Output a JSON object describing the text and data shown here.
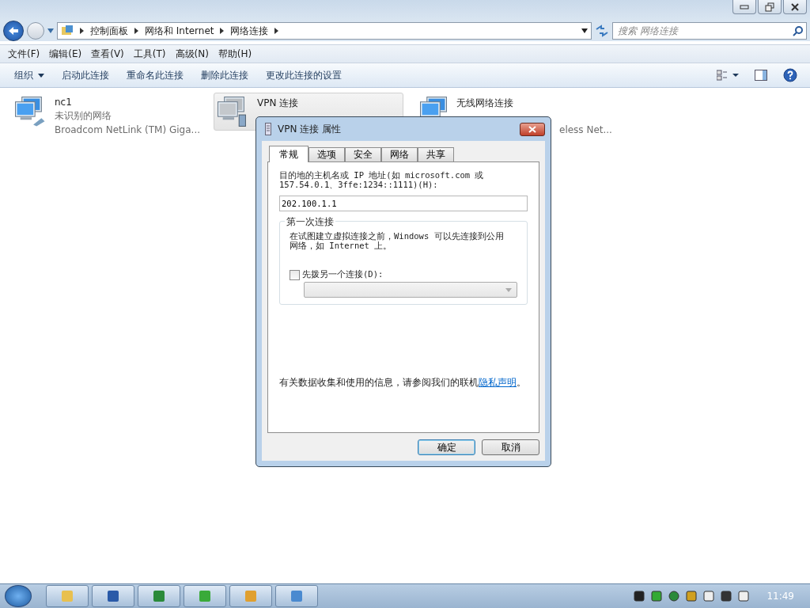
{
  "address_bar": {
    "path": [
      "控制面板",
      "网络和 Internet",
      "网络连接"
    ]
  },
  "search": {
    "placeholder": "搜索 网络连接"
  },
  "menu": [
    "文件(F)",
    "编辑(E)",
    "查看(V)",
    "工具(T)",
    "高级(N)",
    "帮助(H)"
  ],
  "commands": [
    {
      "label": "组织",
      "dropdown": true
    },
    {
      "label": "启动此连接",
      "dropdown": false
    },
    {
      "label": "重命名此连接",
      "dropdown": false
    },
    {
      "label": "删除此连接",
      "dropdown": false
    },
    {
      "label": "更改此连接的设置",
      "dropdown": false
    }
  ],
  "connections": [
    {
      "kind": "wired",
      "name": "nc1",
      "status": "未识别的网络",
      "device": "Broadcom NetLink (TM) Giga...",
      "selected": false
    },
    {
      "kind": "vpn",
      "name": "VPN 连接",
      "selected": true
    },
    {
      "kind": "wireless",
      "name": "无线网络连接",
      "device": "eless Net...",
      "selected": false
    }
  ],
  "dialog": {
    "title": "VPN 连接 属性",
    "tabs": [
      {
        "label": "常规",
        "selected": true
      },
      {
        "label": "选项",
        "selected": false
      },
      {
        "label": "安全",
        "selected": false
      },
      {
        "label": "网络",
        "selected": false
      },
      {
        "label": "共享",
        "selected": false
      }
    ],
    "host_label": "目的地的主机名或 IP 地址(如 microsoft.com 或\n157.54.0.1、3ffe:1234::1111)(H):",
    "host_value": "202.100.1.1",
    "first_connection": {
      "legend": "第一次连接",
      "description": [
        "在试图建立虚拟连接之前，Windows 可以先连接到公用",
        "网络，如 Internet 上。"
      ],
      "dial_first": {
        "label": "先拨另一个连接(D):",
        "checked": false
      },
      "dropdown": {
        "disabled": true
      }
    },
    "privacy": {
      "text": "有关数据收集和使用的信息，请参阅我们的联机",
      "link": "隐私声明",
      "end": "。"
    },
    "buttons": [
      {
        "label": "确定",
        "default": true
      },
      {
        "label": "取消",
        "default": false
      }
    ]
  },
  "taskbar": {
    "clock": "11:49"
  }
}
